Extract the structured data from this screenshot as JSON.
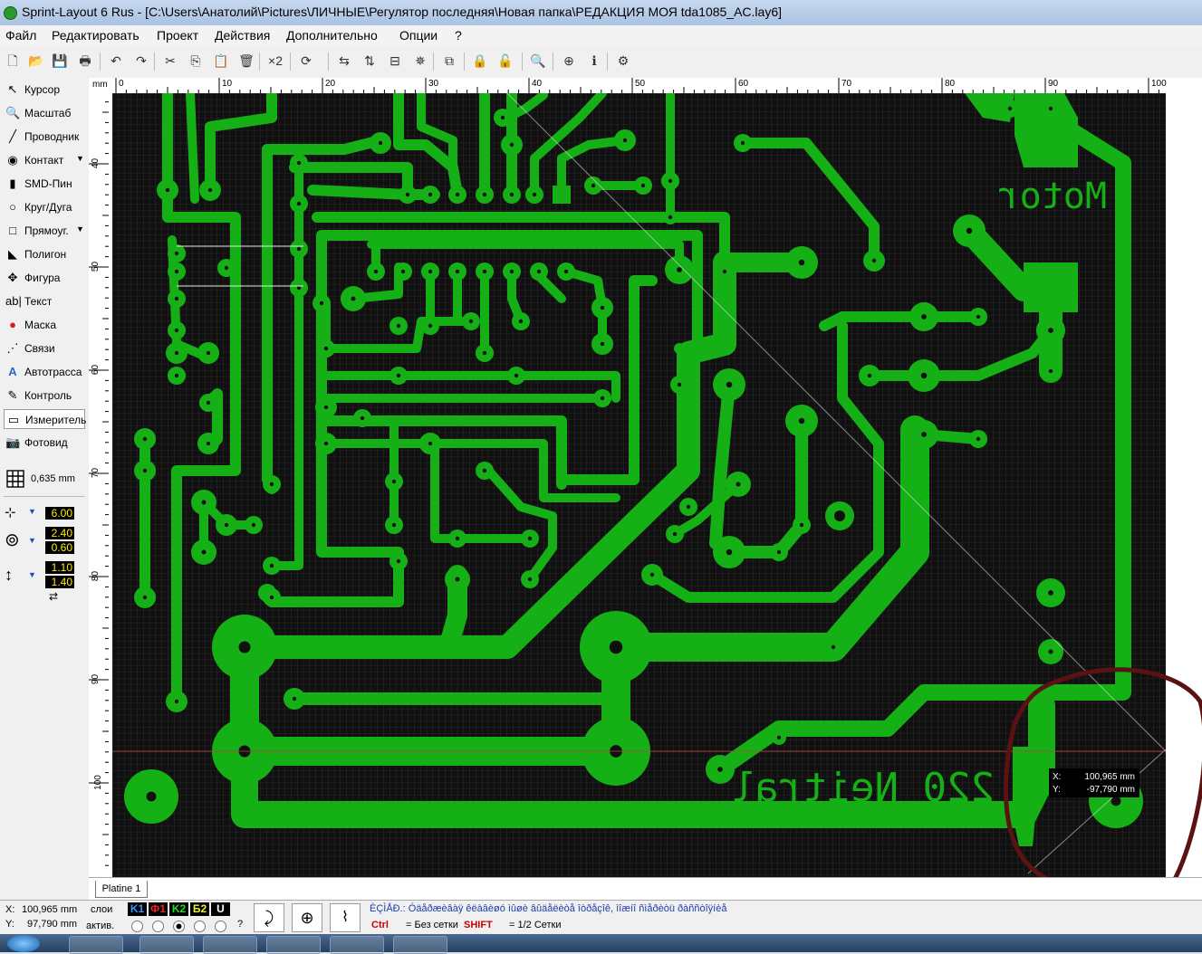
{
  "window": {
    "title": "Sprint-Layout 6 Rus - [C:\\Users\\Анатолий\\Pictures\\ЛИЧНЫЕ\\Регулятор последняя\\Новая папка\\РЕДАКЦИЯ МОЯ tda1085_AC.lay6]"
  },
  "menu": [
    "Файл",
    "Редактировать",
    "Проект",
    "Действия",
    "Дополнительно",
    "Опции",
    "?"
  ],
  "toolbar": {
    "items": [
      {
        "name": "new-file-icon",
        "glyph": "🗋"
      },
      {
        "name": "open-folder-icon",
        "glyph": "📂"
      },
      {
        "name": "save-icon",
        "glyph": "💾"
      },
      {
        "name": "print-icon",
        "glyph": "🖶"
      },
      {
        "name": "undo-icon",
        "glyph": "↶"
      },
      {
        "name": "redo-icon",
        "glyph": "↷"
      },
      {
        "name": "cut-icon",
        "glyph": "✂"
      },
      {
        "name": "copy-icon",
        "glyph": "⎘"
      },
      {
        "name": "paste-icon",
        "glyph": "📋"
      },
      {
        "name": "delete-icon",
        "glyph": "🗑"
      },
      {
        "name": "duplicate-icon",
        "glyph": "×2"
      },
      {
        "name": "rotate-icon",
        "glyph": "⟳"
      },
      {
        "name": "mirror-h-icon",
        "glyph": "⇆"
      },
      {
        "name": "mirror-v-icon",
        "glyph": "⇅"
      },
      {
        "name": "align-icon",
        "glyph": "⊟"
      },
      {
        "name": "group-icon",
        "glyph": "✵"
      },
      {
        "name": "connections-icon",
        "glyph": "⧉"
      },
      {
        "name": "lock-icon",
        "glyph": "🔒"
      },
      {
        "name": "unlock-icon",
        "glyph": "🔓"
      },
      {
        "name": "zoom-icon",
        "glyph": "🔍"
      },
      {
        "name": "snap-icon",
        "glyph": "⊕"
      },
      {
        "name": "info-icon",
        "glyph": "ℹ"
      },
      {
        "name": "gerber-icon",
        "glyph": "⚙"
      }
    ]
  },
  "tools": [
    {
      "name": "tool-cursor",
      "icon": "cursor-icon",
      "glyph": "↖",
      "label": "Курсор"
    },
    {
      "name": "tool-zoom",
      "icon": "magnifier-icon",
      "glyph": "🔍",
      "label": "Масштаб"
    },
    {
      "name": "tool-track",
      "icon": "track-icon",
      "glyph": "╱",
      "label": "Проводник"
    },
    {
      "name": "tool-pad",
      "icon": "pad-icon",
      "glyph": "◉",
      "label": "Контакт",
      "dropdown": true
    },
    {
      "name": "tool-smd",
      "icon": "smd-icon",
      "glyph": "▮",
      "label": "SMD-Пин"
    },
    {
      "name": "tool-circle",
      "icon": "circle-icon",
      "glyph": "○",
      "label": "Круг/Дуга"
    },
    {
      "name": "tool-rect",
      "icon": "rectangle-icon",
      "glyph": "□",
      "label": "Прямоуг.",
      "dropdown": true
    },
    {
      "name": "tool-polygon",
      "icon": "polygon-icon",
      "glyph": "◣",
      "label": "Полигон"
    },
    {
      "name": "tool-figure",
      "icon": "figure-icon",
      "glyph": "✥",
      "label": "Фигура"
    },
    {
      "name": "tool-text",
      "icon": "text-icon",
      "glyph": "ab|",
      "label": "Текст"
    },
    {
      "name": "tool-mask",
      "icon": "mask-icon",
      "glyph": "●",
      "label": "Маска"
    },
    {
      "name": "tool-links",
      "icon": "links-icon",
      "glyph": "⋰",
      "label": "Связи"
    },
    {
      "name": "tool-autoroute",
      "icon": "autoroute-icon",
      "glyph": "A",
      "label": "Автотрасса"
    },
    {
      "name": "tool-check",
      "icon": "check-icon",
      "glyph": "✎",
      "label": "Контроль"
    },
    {
      "name": "tool-measure",
      "icon": "ruler-icon",
      "glyph": "▭",
      "label": "Измеритель",
      "active": true
    },
    {
      "name": "tool-photo",
      "icon": "camera-icon",
      "glyph": "📷",
      "label": "Фотовид"
    }
  ],
  "grid": {
    "value": "0,635 mm"
  },
  "params": {
    "track_width": "6.00",
    "pad_outer": "2.40",
    "pad_inner": "0.60",
    "smd_w": "1.10",
    "smd_h": "1.40"
  },
  "ruler": {
    "unit": "mm",
    "top_labels": [
      "0",
      "10",
      "20",
      "30",
      "40",
      "50",
      "60",
      "70",
      "80",
      "90",
      "100"
    ],
    "left_labels": [
      "40",
      "50",
      "60",
      "70",
      "80",
      "90",
      "100"
    ]
  },
  "board": {
    "texts": [
      "Motor",
      "220 Neitral"
    ],
    "colors": {
      "copper": "#15b015",
      "background": "#101010",
      "grid": "#3c3c3c",
      "annotation": "#5a1212"
    }
  },
  "measure_tooltip": {
    "x_label": "X:",
    "x_value": "100,965 mm",
    "y_label": "Y:",
    "y_value": "-97,790 mm"
  },
  "tab": {
    "label": "Platine 1"
  },
  "status": {
    "x_label": "X:",
    "x_value": "100,965 mm",
    "y_label": "Y:",
    "y_value": "97,790 mm",
    "layers_label": "слои",
    "active_label": "актив.",
    "layers": [
      "K1",
      "Ф1",
      "K2",
      "Б2",
      "U"
    ],
    "help_question": "?",
    "encoded_text": "ÈÇÌÅÐ.: Óäåðæèâàÿ êëàâèøó ìûøè âûäåëèòå îòðåçîê, ìîæíî ñìåðèòü ðàññòîÿíèå",
    "hint_ctrl_key": "Ctrl",
    "hint_ctrl_text": "= Без сетки",
    "hint_shift_key": "SHIFT",
    "hint_shift_text": "= 1/2 Сетки"
  }
}
